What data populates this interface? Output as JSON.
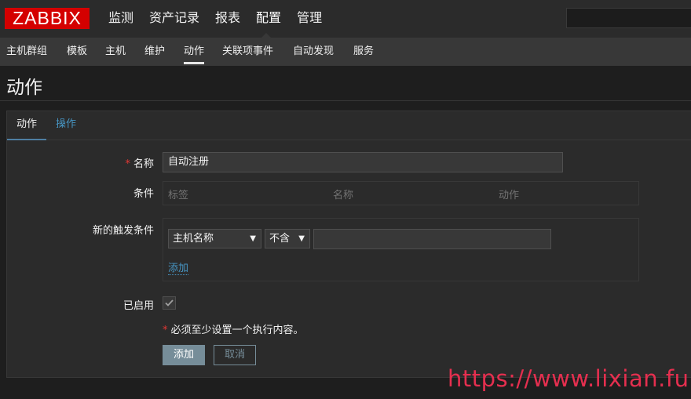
{
  "topnav": {
    "logo": "ZABBIX",
    "menu": [
      "监测",
      "资产记录",
      "报表",
      "配置",
      "管理"
    ],
    "selected": "配置"
  },
  "subnav": {
    "items": [
      "主机群组",
      "模板",
      "主机",
      "维护",
      "动作",
      "关联项事件",
      "自动发现",
      "服务"
    ],
    "active": "动作"
  },
  "page": {
    "title": "动作"
  },
  "tabs": {
    "action": "动作",
    "operations": "操作"
  },
  "form": {
    "name_label": "名称",
    "name_value": "自动注册",
    "conditions_label": "条件",
    "conditions_headers": [
      "标签",
      "名称",
      "动作"
    ],
    "new_condition_label": "新的触发条件",
    "condition_type": "主机名称",
    "condition_operator": "不含",
    "condition_value": "",
    "add_link": "添加",
    "enabled_label": "已启用",
    "enabled": true,
    "note": "必须至少设置一个执行内容。",
    "add_button": "添加",
    "cancel_button": "取消"
  },
  "watermark": "https://www.lixian.fun",
  "colors": {
    "logo_bg": "#d40000",
    "link": "#4796c4",
    "required": "#e33734",
    "primary_button": "#768d99",
    "watermark": "#e52f4f"
  }
}
